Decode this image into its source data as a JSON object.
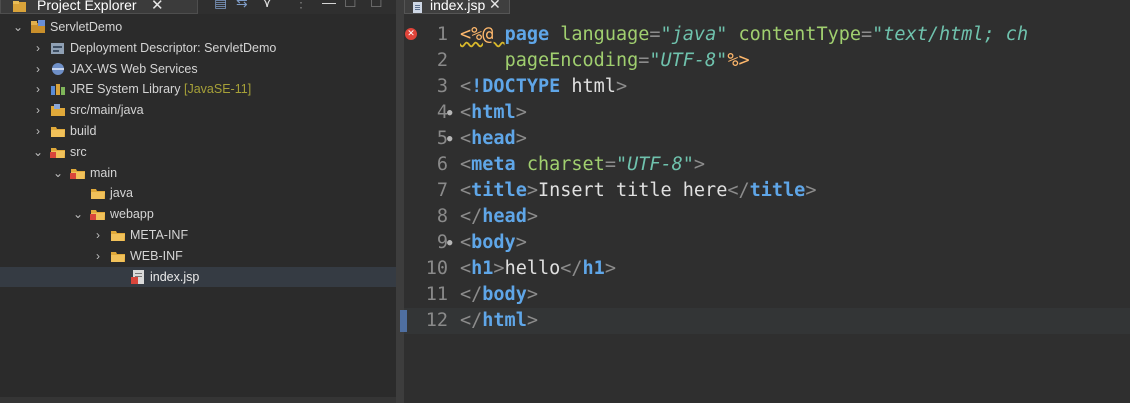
{
  "project_explorer": {
    "tab_label": "Project Explorer",
    "close_glyph": "✕",
    "toolbar": [
      "▤",
      "⇆",
      "⋎",
      "⋮",
      "—",
      "☐"
    ],
    "tree": [
      {
        "label": "ServletDemo",
        "twisty": "open",
        "icon": "project-icon",
        "indent": 0
      },
      {
        "label": "Deployment Descriptor: ServletDemo",
        "twisty": "closed",
        "icon": "deployment-descriptor-icon",
        "indent": 1
      },
      {
        "label": "JAX-WS Web Services",
        "twisty": "closed",
        "icon": "web-services-icon",
        "indent": 1
      },
      {
        "label": "JRE System Library",
        "decoration": "[JavaSE-11]",
        "twisty": "closed",
        "icon": "library-icon",
        "indent": 1
      },
      {
        "label": "src/main/java",
        "twisty": "closed",
        "icon": "source-folder-icon",
        "indent": 1
      },
      {
        "label": "build",
        "twisty": "closed",
        "icon": "folder-icon",
        "indent": 1
      },
      {
        "label": "src",
        "twisty": "open",
        "icon": "folder-error-icon",
        "indent": 1
      },
      {
        "label": "main",
        "twisty": "open",
        "icon": "folder-error-icon",
        "indent": 2
      },
      {
        "label": "java",
        "twisty": "none",
        "icon": "folder-icon",
        "indent": 3
      },
      {
        "label": "webapp",
        "twisty": "open",
        "icon": "folder-error-icon",
        "indent": 3
      },
      {
        "label": "META-INF",
        "twisty": "closed",
        "icon": "folder-icon",
        "indent": 4
      },
      {
        "label": "WEB-INF",
        "twisty": "closed",
        "icon": "folder-icon",
        "indent": 4
      },
      {
        "label": "index.jsp",
        "twisty": "none",
        "icon": "jsp-file-error-icon",
        "indent": 5,
        "selected": true
      }
    ]
  },
  "editor": {
    "tab_label": "index.jsp",
    "close_glyph": "✕",
    "lines": [
      {
        "num": "1",
        "error": true,
        "tokens": [
          [
            "dir",
            "<%@ "
          ],
          [
            "kw",
            "page "
          ],
          [
            "attr",
            "language"
          ],
          [
            "punc",
            "="
          ],
          [
            "str",
            "\"java\""
          ],
          [
            "plain",
            " "
          ],
          [
            "attr",
            "contentType"
          ],
          [
            "punc",
            "="
          ],
          [
            "str",
            "\"text/html; ch"
          ]
        ]
      },
      {
        "num": "2",
        "tokens": [
          [
            "plain",
            "    "
          ],
          [
            "attr",
            "pageEncoding"
          ],
          [
            "punc",
            "="
          ],
          [
            "str",
            "\"UTF-8\""
          ],
          [
            "dir",
            "%>"
          ]
        ]
      },
      {
        "num": "3",
        "tokens": [
          [
            "punc",
            "<"
          ],
          [
            "doctype",
            "!DOCTYPE "
          ],
          [
            "plain",
            "html"
          ],
          [
            "punc",
            ">"
          ]
        ]
      },
      {
        "num": "4",
        "fold": true,
        "tokens": [
          [
            "punc",
            "<"
          ],
          [
            "tag",
            "html"
          ],
          [
            "punc",
            ">"
          ]
        ]
      },
      {
        "num": "5",
        "fold": true,
        "tokens": [
          [
            "punc",
            "<"
          ],
          [
            "tag",
            "head"
          ],
          [
            "punc",
            ">"
          ]
        ]
      },
      {
        "num": "6",
        "tokens": [
          [
            "punc",
            "<"
          ],
          [
            "tag",
            "meta "
          ],
          [
            "attr",
            "charset"
          ],
          [
            "punc",
            "="
          ],
          [
            "str",
            "\"UTF-8\""
          ],
          [
            "punc",
            ">"
          ]
        ]
      },
      {
        "num": "7",
        "tokens": [
          [
            "punc",
            "<"
          ],
          [
            "tag",
            "title"
          ],
          [
            "punc",
            ">"
          ],
          [
            "plain",
            "Insert title here"
          ],
          [
            "punc",
            "</"
          ],
          [
            "tag",
            "title"
          ],
          [
            "punc",
            ">"
          ]
        ]
      },
      {
        "num": "8",
        "tokens": [
          [
            "punc",
            "</"
          ],
          [
            "tag",
            "head"
          ],
          [
            "punc",
            ">"
          ]
        ]
      },
      {
        "num": "9",
        "fold": true,
        "tokens": [
          [
            "punc",
            "<"
          ],
          [
            "tag",
            "body"
          ],
          [
            "punc",
            ">"
          ]
        ]
      },
      {
        "num": "10",
        "tokens": [
          [
            "punc",
            "<"
          ],
          [
            "tag",
            "h1"
          ],
          [
            "punc",
            ">"
          ],
          [
            "plain",
            "hello"
          ],
          [
            "punc",
            "</"
          ],
          [
            "tag",
            "h1"
          ],
          [
            "punc",
            ">"
          ]
        ]
      },
      {
        "num": "11",
        "tokens": [
          [
            "punc",
            "</"
          ],
          [
            "tag",
            "body"
          ],
          [
            "punc",
            ">"
          ]
        ]
      },
      {
        "num": "12",
        "current": true,
        "tokens": [
          [
            "punc",
            "</"
          ],
          [
            "tag",
            "html"
          ],
          [
            "punc",
            ">"
          ]
        ]
      }
    ]
  }
}
